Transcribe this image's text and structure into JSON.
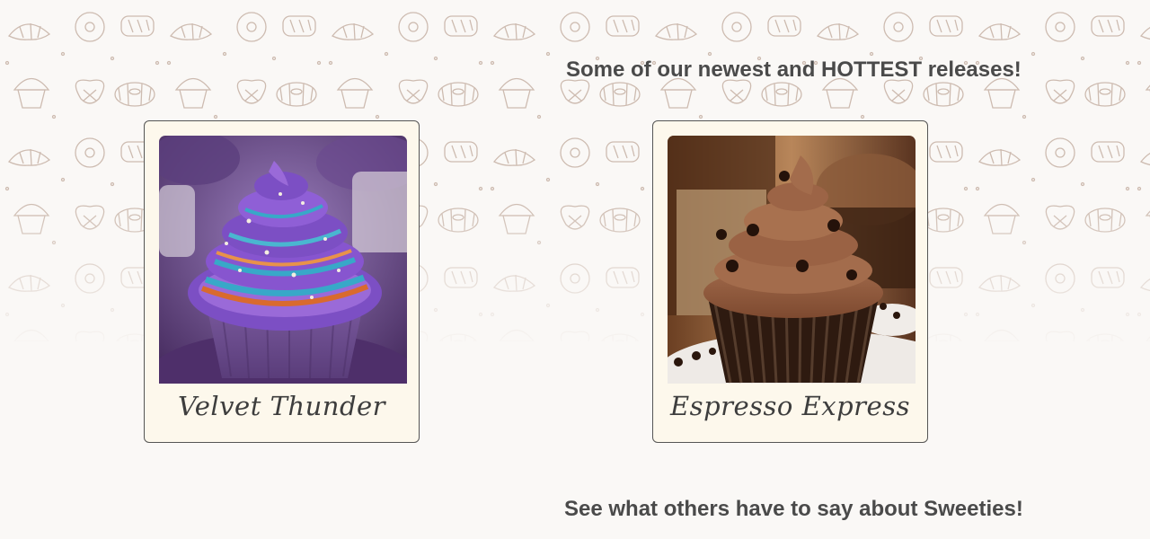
{
  "background": {
    "pattern_icon": "bakery-doodle-pattern",
    "pattern_color": "#c9b5a8",
    "page_color": "#faf8f6"
  },
  "releases": {
    "heading": "Some of our newest and HOTTEST releases!",
    "products": [
      {
        "name": "Velvet Thunder",
        "image_icon": "purple-galaxy-cupcake",
        "image_colors": [
          "#7c4fc4",
          "#38a8c8",
          "#d96a2e",
          "#6e4a8a"
        ]
      },
      {
        "name": "Espresso Express",
        "image_icon": "chocolate-espresso-cupcake",
        "image_colors": [
          "#8b5a3c",
          "#2e1a10",
          "#b88862"
        ]
      }
    ]
  },
  "reviews": {
    "heading": "See what others have to say about Sweeties!"
  },
  "colors": {
    "heading_text": "#4a4a4a",
    "card_background": "#fdf8ec",
    "card_border": "#555555"
  }
}
